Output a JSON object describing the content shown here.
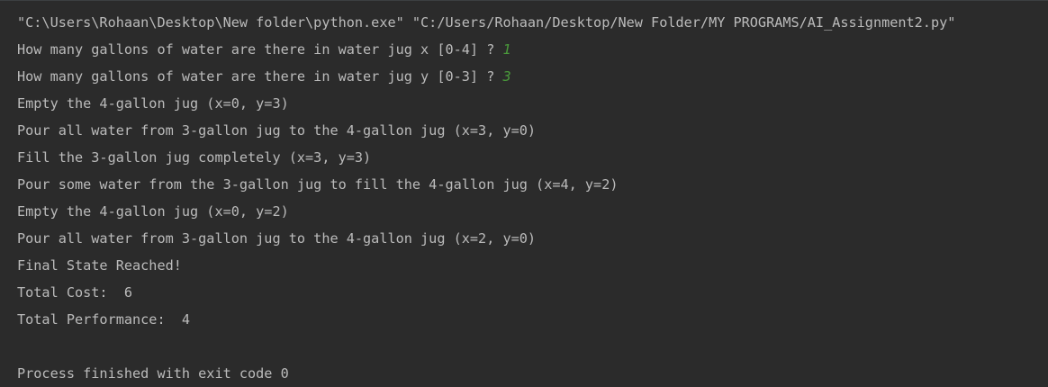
{
  "console": {
    "command": "\"C:\\Users\\Rohaan\\Desktop\\New folder\\python.exe\" \"C:/Users/Rohaan/Desktop/New Folder/MY PROGRAMS/AI_Assignment2.py\"",
    "prompt_x": "How many gallons of water are there in water jug x [0-4] ? ",
    "input_x": "1",
    "prompt_y": "How many gallons of water are there in water jug y [0-3] ? ",
    "input_y": "3",
    "steps": [
      "Empty the 4-gallon jug (x=0, y=3)",
      "Pour all water from 3-gallon jug to the 4-gallon jug (x=3, y=0)",
      "Fill the 3-gallon jug completely (x=3, y=3)",
      "Pour some water from the 3-gallon jug to fill the 4-gallon jug (x=4, y=2)",
      "Empty the 4-gallon jug (x=0, y=2)",
      "Pour all water from 3-gallon jug to the 4-gallon jug (x=2, y=0)"
    ],
    "final_state": "Final State Reached!",
    "total_cost": "Total Cost:  6",
    "total_performance": "Total Performance:  4",
    "exit_message": "Process finished with exit code 0"
  },
  "colors": {
    "background": "#2b2b2b",
    "text": "#bbbbbb",
    "user_input": "#4a9a3b"
  }
}
